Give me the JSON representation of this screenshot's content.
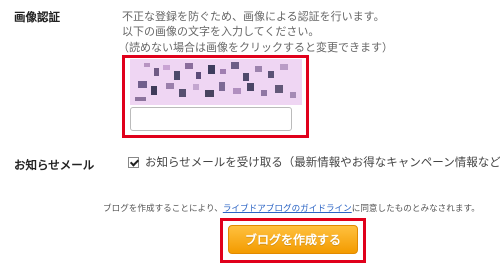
{
  "image_auth": {
    "label": "画像認証",
    "line1": "不正な登録を防ぐため、画像による認証を行います。",
    "line2": "以下の画像の文字を入力してください。",
    "line3": "（読めない場合は画像をクリックすると変更できます）",
    "input_value": ""
  },
  "newsletter": {
    "label": "お知らせメール",
    "checkbox_label": "お知らせメールを受け取る（最新情報やお得なキャンペーン情報など）",
    "checked": true
  },
  "terms": {
    "before": "ブログを作成することにより、",
    "link": "ライブドアブログのガイドライン",
    "after": "に同意したものとみなされます。"
  },
  "submit": {
    "label": "ブログを作成する"
  },
  "colors": {
    "highlight_border": "#e0001b",
    "button_orange": "#f5a100",
    "link_blue": "#2a63c4",
    "captcha_background": "#efd6f3"
  }
}
